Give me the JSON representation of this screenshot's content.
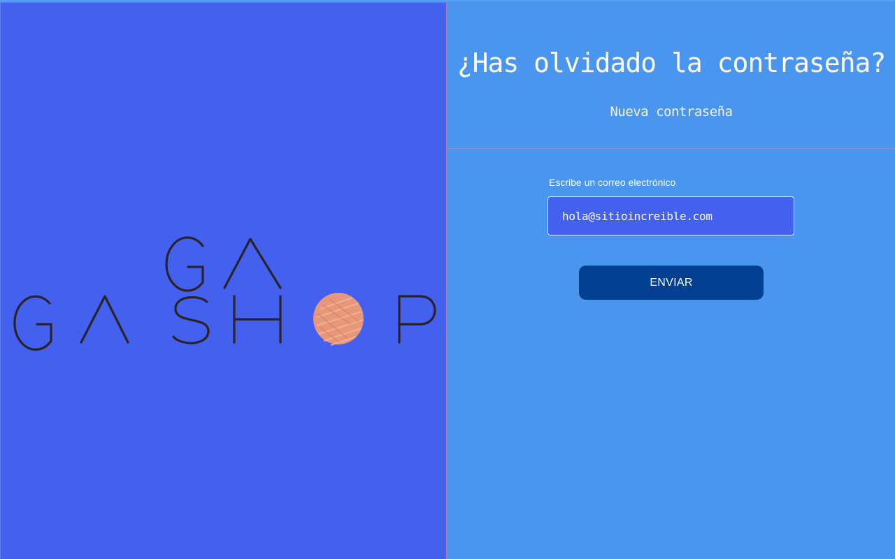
{
  "brand": {
    "logo_text_top": "GA",
    "logo_text_bottom": "GASHOP",
    "logo_colors": {
      "letters": "#2a2224",
      "dot": "#e8987a"
    }
  },
  "colors": {
    "left_panel": "#4361ee",
    "right_panel": "#4a95ee",
    "button": "#003f92",
    "text": "#ffffff"
  },
  "header": {
    "title": "¿Has olvidado la contraseña?",
    "subtitle": "Nueva contraseña"
  },
  "form": {
    "email_label": "Escribe un correo electrónico",
    "email_value": "hola@sitioincreible.com",
    "submit_label": "ENVIAR"
  }
}
